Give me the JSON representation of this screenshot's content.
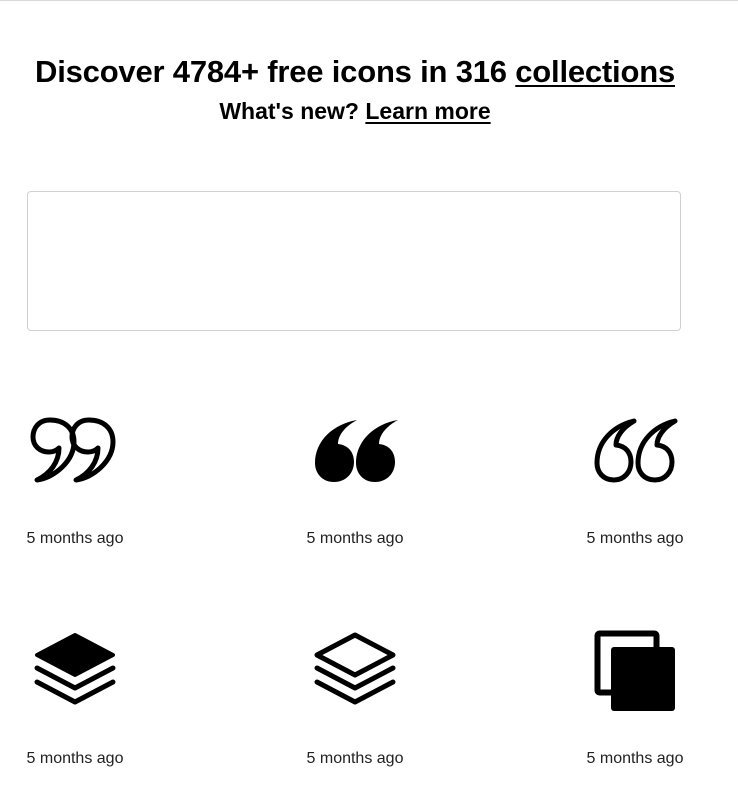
{
  "hero": {
    "title_prefix": "Discover 4784+ free icons in 316",
    "title_link": "collections",
    "whats_new": "What's new?",
    "learn_more": "Learn more"
  },
  "search": {
    "placeholder": "",
    "value": ""
  },
  "icons": [
    {
      "icon": "quote-close-outline-icon",
      "time": "5 months ago"
    },
    {
      "icon": "quote-open-filled-icon",
      "time": "5 months ago"
    },
    {
      "icon": "quote-open-outline-icon",
      "time": "5 months ago"
    },
    {
      "icon": "layers-filled-icon",
      "time": "5 months ago"
    },
    {
      "icon": "layers-outline-icon",
      "time": "5 months ago"
    },
    {
      "icon": "copy-filled-icon",
      "time": "5 months ago"
    }
  ],
  "colors": {
    "text": "#000000",
    "border": "#d0d0d0",
    "background": "#ffffff"
  }
}
